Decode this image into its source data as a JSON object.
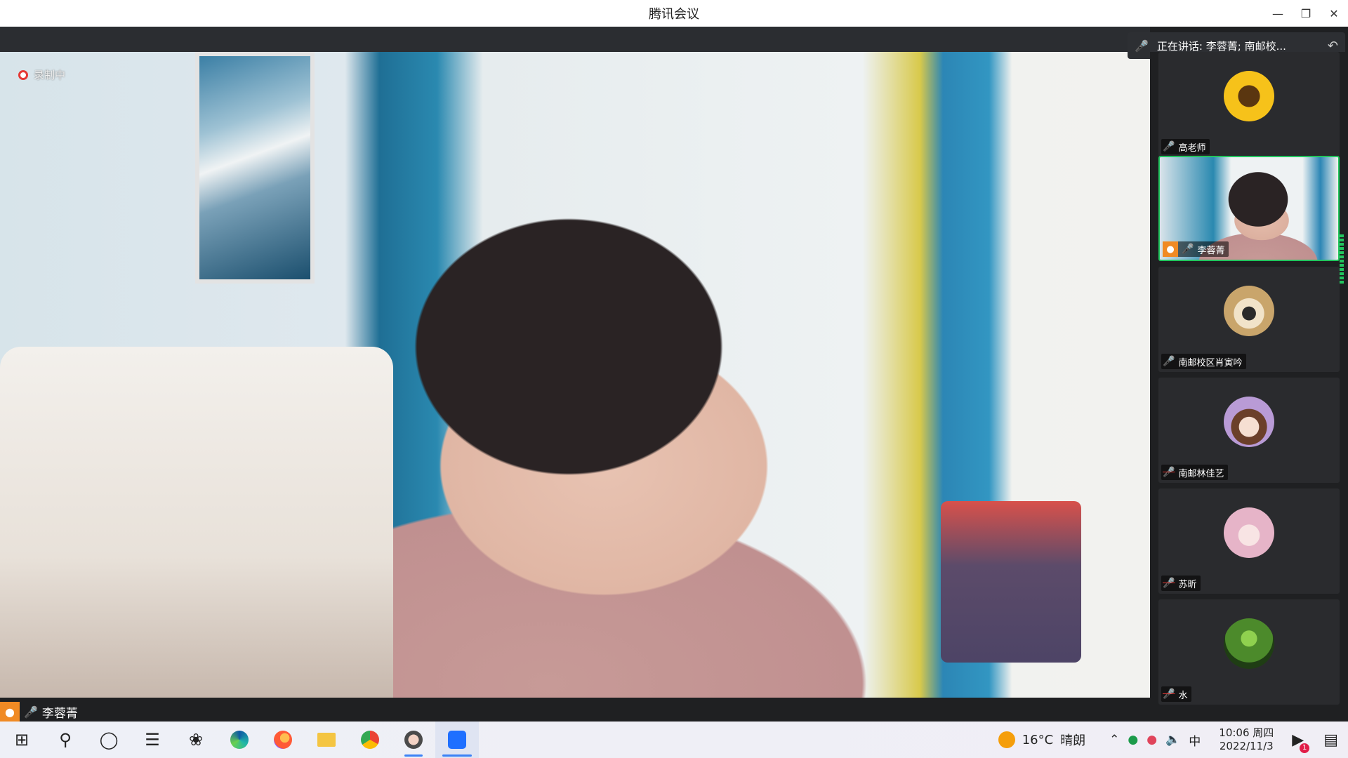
{
  "window": {
    "title": "腾讯会议",
    "minimize_icon": "—",
    "restore_icon": "❐",
    "close_icon": "✕"
  },
  "main_video": {
    "recording_label": "录制中",
    "participant_name": "李蓉菁"
  },
  "speaking_banner": {
    "text": "正在讲话: 李蓉菁; 南邮校..."
  },
  "participants": [
    {
      "name": "高老师",
      "mic": "on",
      "avatar": "sunflower",
      "avatar_color": "#f6c21a"
    },
    {
      "name": "李蓉菁",
      "mic": "active",
      "avatar": "video",
      "is_host": true
    },
    {
      "name": "南邮校区肖寅吟",
      "mic": "on",
      "avatar": "cartoon-girl",
      "avatar_color": "#c9a56b"
    },
    {
      "name": "南邮林佳艺",
      "mic": "muted",
      "avatar": "anime-girl-purple",
      "avatar_color": "#b99bd6"
    },
    {
      "name": "苏昕",
      "mic": "muted",
      "avatar": "anime-girl-pink",
      "avatar_color": "#e6b4c8"
    },
    {
      "name": "水",
      "mic": "muted",
      "avatar": "green-tree",
      "avatar_color": "#4c8a2b"
    }
  ],
  "taskbar": {
    "weather_temp": "16°C",
    "weather_text": "晴朗",
    "ime": "中",
    "time": "10:06 周四",
    "date": "2022/11/3",
    "notification_count": "1"
  },
  "colors": {
    "active_border": "#22c55e",
    "host_badge": "#f08a24",
    "record_red": "#e53935"
  }
}
